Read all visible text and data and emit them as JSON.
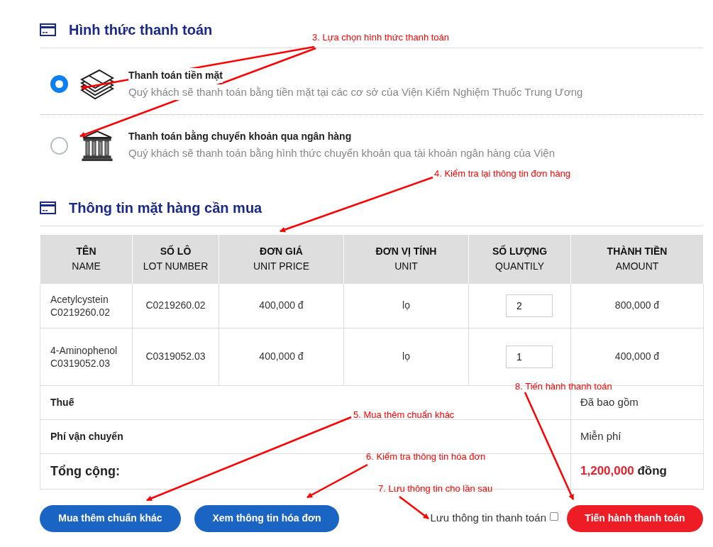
{
  "payment_section": {
    "title": "Hình thức thanh toán",
    "options": [
      {
        "kind": "cash",
        "title": "Thanh toán tiền mặt",
        "description": "Quý khách sẽ thanh toán bằng tiền mặt tại các cơ sở của Viện Kiểm Nghiệm Thuốc Trung Ương",
        "selected": true
      },
      {
        "kind": "bank",
        "title": "Thanh toán bằng chuyển khoản qua ngân hàng",
        "description": "Quý khách sẽ thanh toán bằng hình thức chuyển khoản qua tài khoản ngân hàng của Viện",
        "selected": false
      }
    ]
  },
  "items_section": {
    "title": "Thông tin mặt hàng cần mua",
    "table": {
      "columns": [
        {
          "vi": "TÊN",
          "en": "NAME"
        },
        {
          "vi": "SỐ LÔ",
          "en": "LOT NUMBER"
        },
        {
          "vi": "ĐƠN GIÁ",
          "en": "UNIT PRICE"
        },
        {
          "vi": "ĐƠN VỊ TÍNH",
          "en": "UNIT"
        },
        {
          "vi": "SỐ LƯỢNG",
          "en": "QUANTILY"
        },
        {
          "vi": "THÀNH TIỀN",
          "en": "AMOUNT"
        }
      ],
      "rows": [
        {
          "name": "Acetylcystein C0219260.02",
          "lot": "C0219260.02",
          "unit_price": "400,000 đ",
          "unit": "lọ",
          "quantity": "2",
          "amount": "800,000 đ"
        },
        {
          "name": "4-Aminophenol C0319052.03",
          "lot": "C0319052.03",
          "unit_price": "400,000 đ",
          "unit": "lọ",
          "quantity": "1",
          "amount": "400,000 đ"
        }
      ],
      "summary": [
        {
          "label": "Thuế",
          "value": "Đã bao gồm"
        },
        {
          "label": "Phí vận chuyển",
          "value": "Miễn phí"
        }
      ],
      "total": {
        "label": "Tổng cộng:",
        "amount": "1,200,000",
        "unit": "đồng"
      }
    }
  },
  "actions": {
    "more_button": "Mua thêm chuẩn khác",
    "invoice_button": "Xem thông tin hóa đơn",
    "save_label": "Lưu thông tin thanh toán",
    "save_checked": false,
    "pay_button": "Tiến hành thanh toán"
  },
  "annotations": [
    "3. Lựa chọn hình thức thanh toán",
    "4. Kiểm tra lại thông tin đơn hàng",
    "8. Tiến hành thanh toán",
    "5. Mua thêm chuẩn khác",
    "6. Kiểm tra thông tin hóa đơn",
    "7. Lưu thông tin cho lần sau"
  ]
}
